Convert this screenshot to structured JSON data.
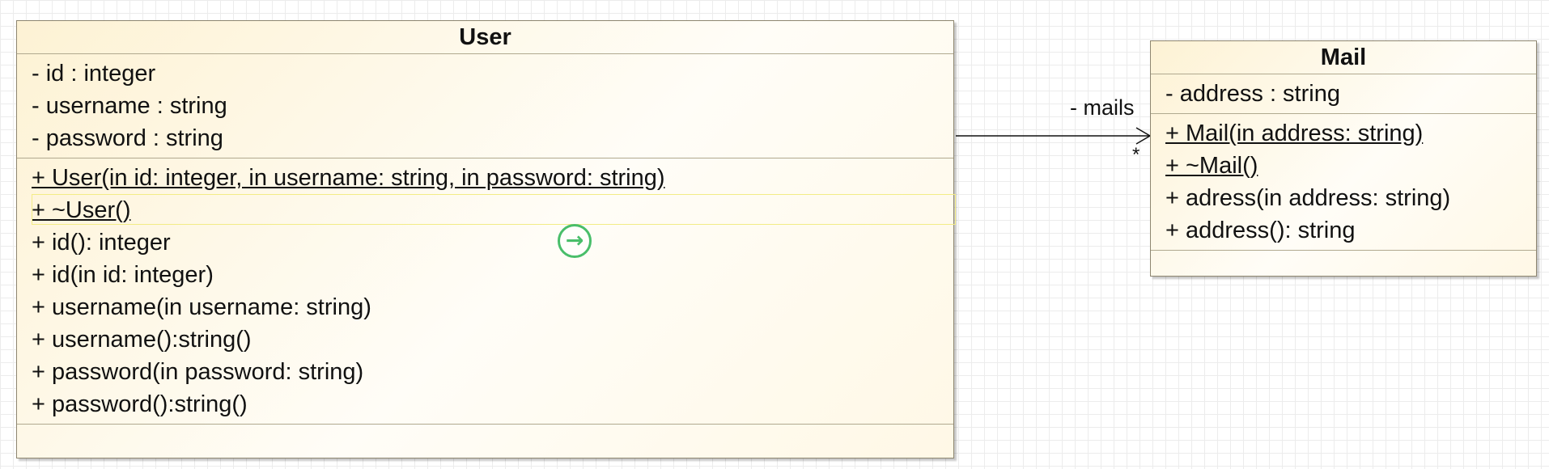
{
  "user_class": {
    "name": "User",
    "attributes": [
      "- id : integer",
      "- username : string",
      "- password : string"
    ],
    "operations": [
      "+ User(in id: integer, in username: string, in password: string)",
      "+ ~User()",
      "+ id(): integer",
      "+ id(in id: integer)",
      "+ username(in username: string)",
      "+ username():string()",
      "+ password(in password: string)",
      "+ password():string()"
    ]
  },
  "mail_class": {
    "name": "Mail",
    "attributes": [
      "- address : string"
    ],
    "operations": [
      "+ Mail(in address: string)",
      "+ ~Mail()",
      "+ adress(in address: string)",
      "+ address(): string"
    ]
  },
  "association": {
    "role": "- mails",
    "multiplicity": "*"
  },
  "icons": {
    "navigate": "arrow-right-circle-icon"
  },
  "colors": {
    "class_fill": "#fdf2d4",
    "class_border": "#8e8670",
    "selection": "#f3ec86",
    "navigate_icon": "#49be6a"
  }
}
